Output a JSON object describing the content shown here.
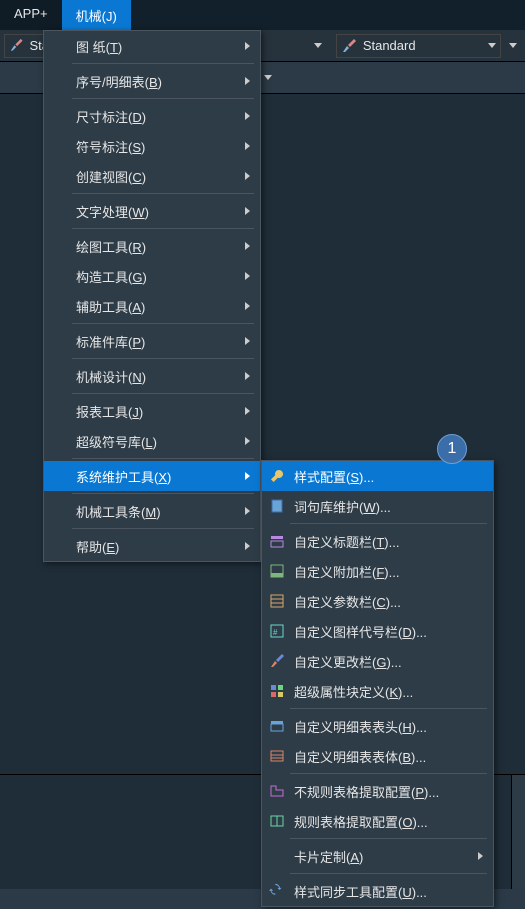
{
  "menubar": {
    "items": [
      {
        "label": "APP+"
      },
      {
        "label": "机械(J)"
      }
    ]
  },
  "toolbar": {
    "left_prefix": "Sta",
    "right_label": "Standard"
  },
  "menu1": [
    {
      "label": "图    纸(T)",
      "submenu": true,
      "sep_after": true
    },
    {
      "label": "序号/明细表(B)",
      "submenu": true,
      "sep_after": true
    },
    {
      "label": "尺寸标注(D)",
      "submenu": true
    },
    {
      "label": "符号标注(S)",
      "submenu": true
    },
    {
      "label": "创建视图(C)",
      "submenu": true,
      "sep_after": true
    },
    {
      "label": "文字处理(W)",
      "submenu": true,
      "sep_after": true
    },
    {
      "label": "绘图工具(R)",
      "submenu": true
    },
    {
      "label": "构造工具(G)",
      "submenu": true
    },
    {
      "label": "辅助工具(A)",
      "submenu": true,
      "sep_after": true
    },
    {
      "label": "标准件库(P)",
      "submenu": true,
      "sep_after": true
    },
    {
      "label": "机械设计(N)",
      "submenu": true,
      "sep_after": true
    },
    {
      "label": "报表工具(J)",
      "submenu": true
    },
    {
      "label": "超级符号库(L)",
      "submenu": true,
      "sep_after": true
    },
    {
      "label": "系统维护工具(X)",
      "submenu": true,
      "hovered": true,
      "sep_after": true
    },
    {
      "label": "机械工具条(M)",
      "submenu": true,
      "sep_after": true
    },
    {
      "label": "帮助(E)",
      "submenu": true
    }
  ],
  "menu2": [
    {
      "label": "样式配置(S)...",
      "hovered": true,
      "icon": "wrench"
    },
    {
      "label": "词句库维护(W)...",
      "sep_after": true,
      "icon": "book"
    },
    {
      "label": "自定义标题栏(T)...",
      "icon": "title"
    },
    {
      "label": "自定义附加栏(F)...",
      "icon": "append"
    },
    {
      "label": "自定义参数栏(C)...",
      "icon": "param"
    },
    {
      "label": "自定义图样代号栏(D)...",
      "icon": "code"
    },
    {
      "label": "自定义更改栏(G)...",
      "icon": "change"
    },
    {
      "label": "超级属性块定义(K)...",
      "sep_after": true,
      "icon": "block"
    },
    {
      "label": "自定义明细表表头(H)...",
      "icon": "theadr"
    },
    {
      "label": "自定义明细表表体(B)...",
      "sep_after": true,
      "icon": "tbody"
    },
    {
      "label": "不规则表格提取配置(P)...",
      "icon": "irreg"
    },
    {
      "label": "规则表格提取配置(O)...",
      "sep_after": true,
      "icon": "reg"
    },
    {
      "label": "卡片定制(A)",
      "submenu": true,
      "sep_after": true
    },
    {
      "label": "样式同步工具配置(U)...",
      "icon": "sync"
    }
  ],
  "badge": "1"
}
